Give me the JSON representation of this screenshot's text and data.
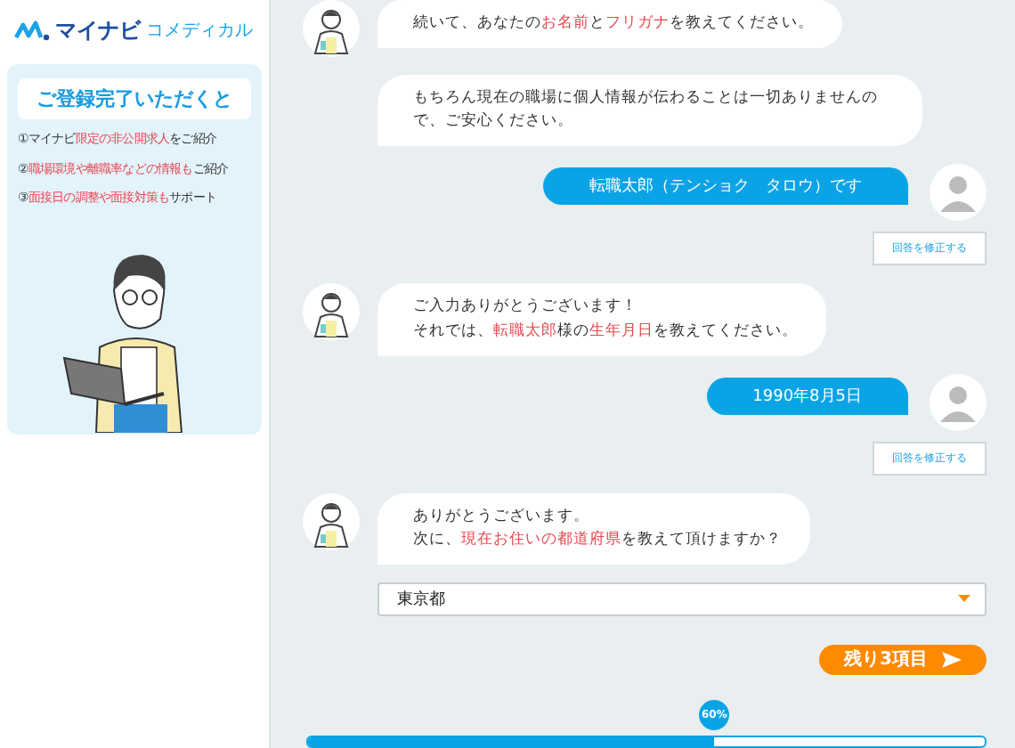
{
  "logo": {
    "brand": "マイナビ",
    "sub": "コメディカル"
  },
  "promo": {
    "title": "ご登録完了いただくと",
    "items": [
      "①マイナビ**限定の非公開求人**をご紹介",
      "②**職場環境や離職率などの情報も**ご紹介",
      "③**面接日の調整や面接対策も**サポート"
    ]
  },
  "messages": [
    {
      "kind": "bot",
      "avatar": true,
      "lines": [
        "続いて、あなたの**お名前**と**フリガナ**を教えてください。"
      ]
    },
    {
      "kind": "bot",
      "avatar": false,
      "lines": [
        "もちろん現在の職場に個人情報が伝わることは一切ありませんので、ご安心ください。"
      ]
    },
    {
      "kind": "user",
      "text": "転職太郎（テンショク　タロウ）です",
      "edit_label": "回答を修正する"
    },
    {
      "kind": "bot",
      "avatar": true,
      "lines": [
        "ご入力ありがとうございます！",
        "それでは、**転職太郎**様の**生年月日**を教えてください。"
      ]
    },
    {
      "kind": "user",
      "text": "1990年8月5日",
      "edit_label": "回答を修正する"
    },
    {
      "kind": "bot",
      "avatar": true,
      "lines": [
        "ありがとうございます。",
        "次に、**現在お住いの都道府県**を教えて頂けますか？"
      ]
    }
  ],
  "prefecture_select": {
    "value": "東京都"
  },
  "next_button": "残り3項目",
  "progress": {
    "level": 0.6,
    "label": "60%"
  }
}
